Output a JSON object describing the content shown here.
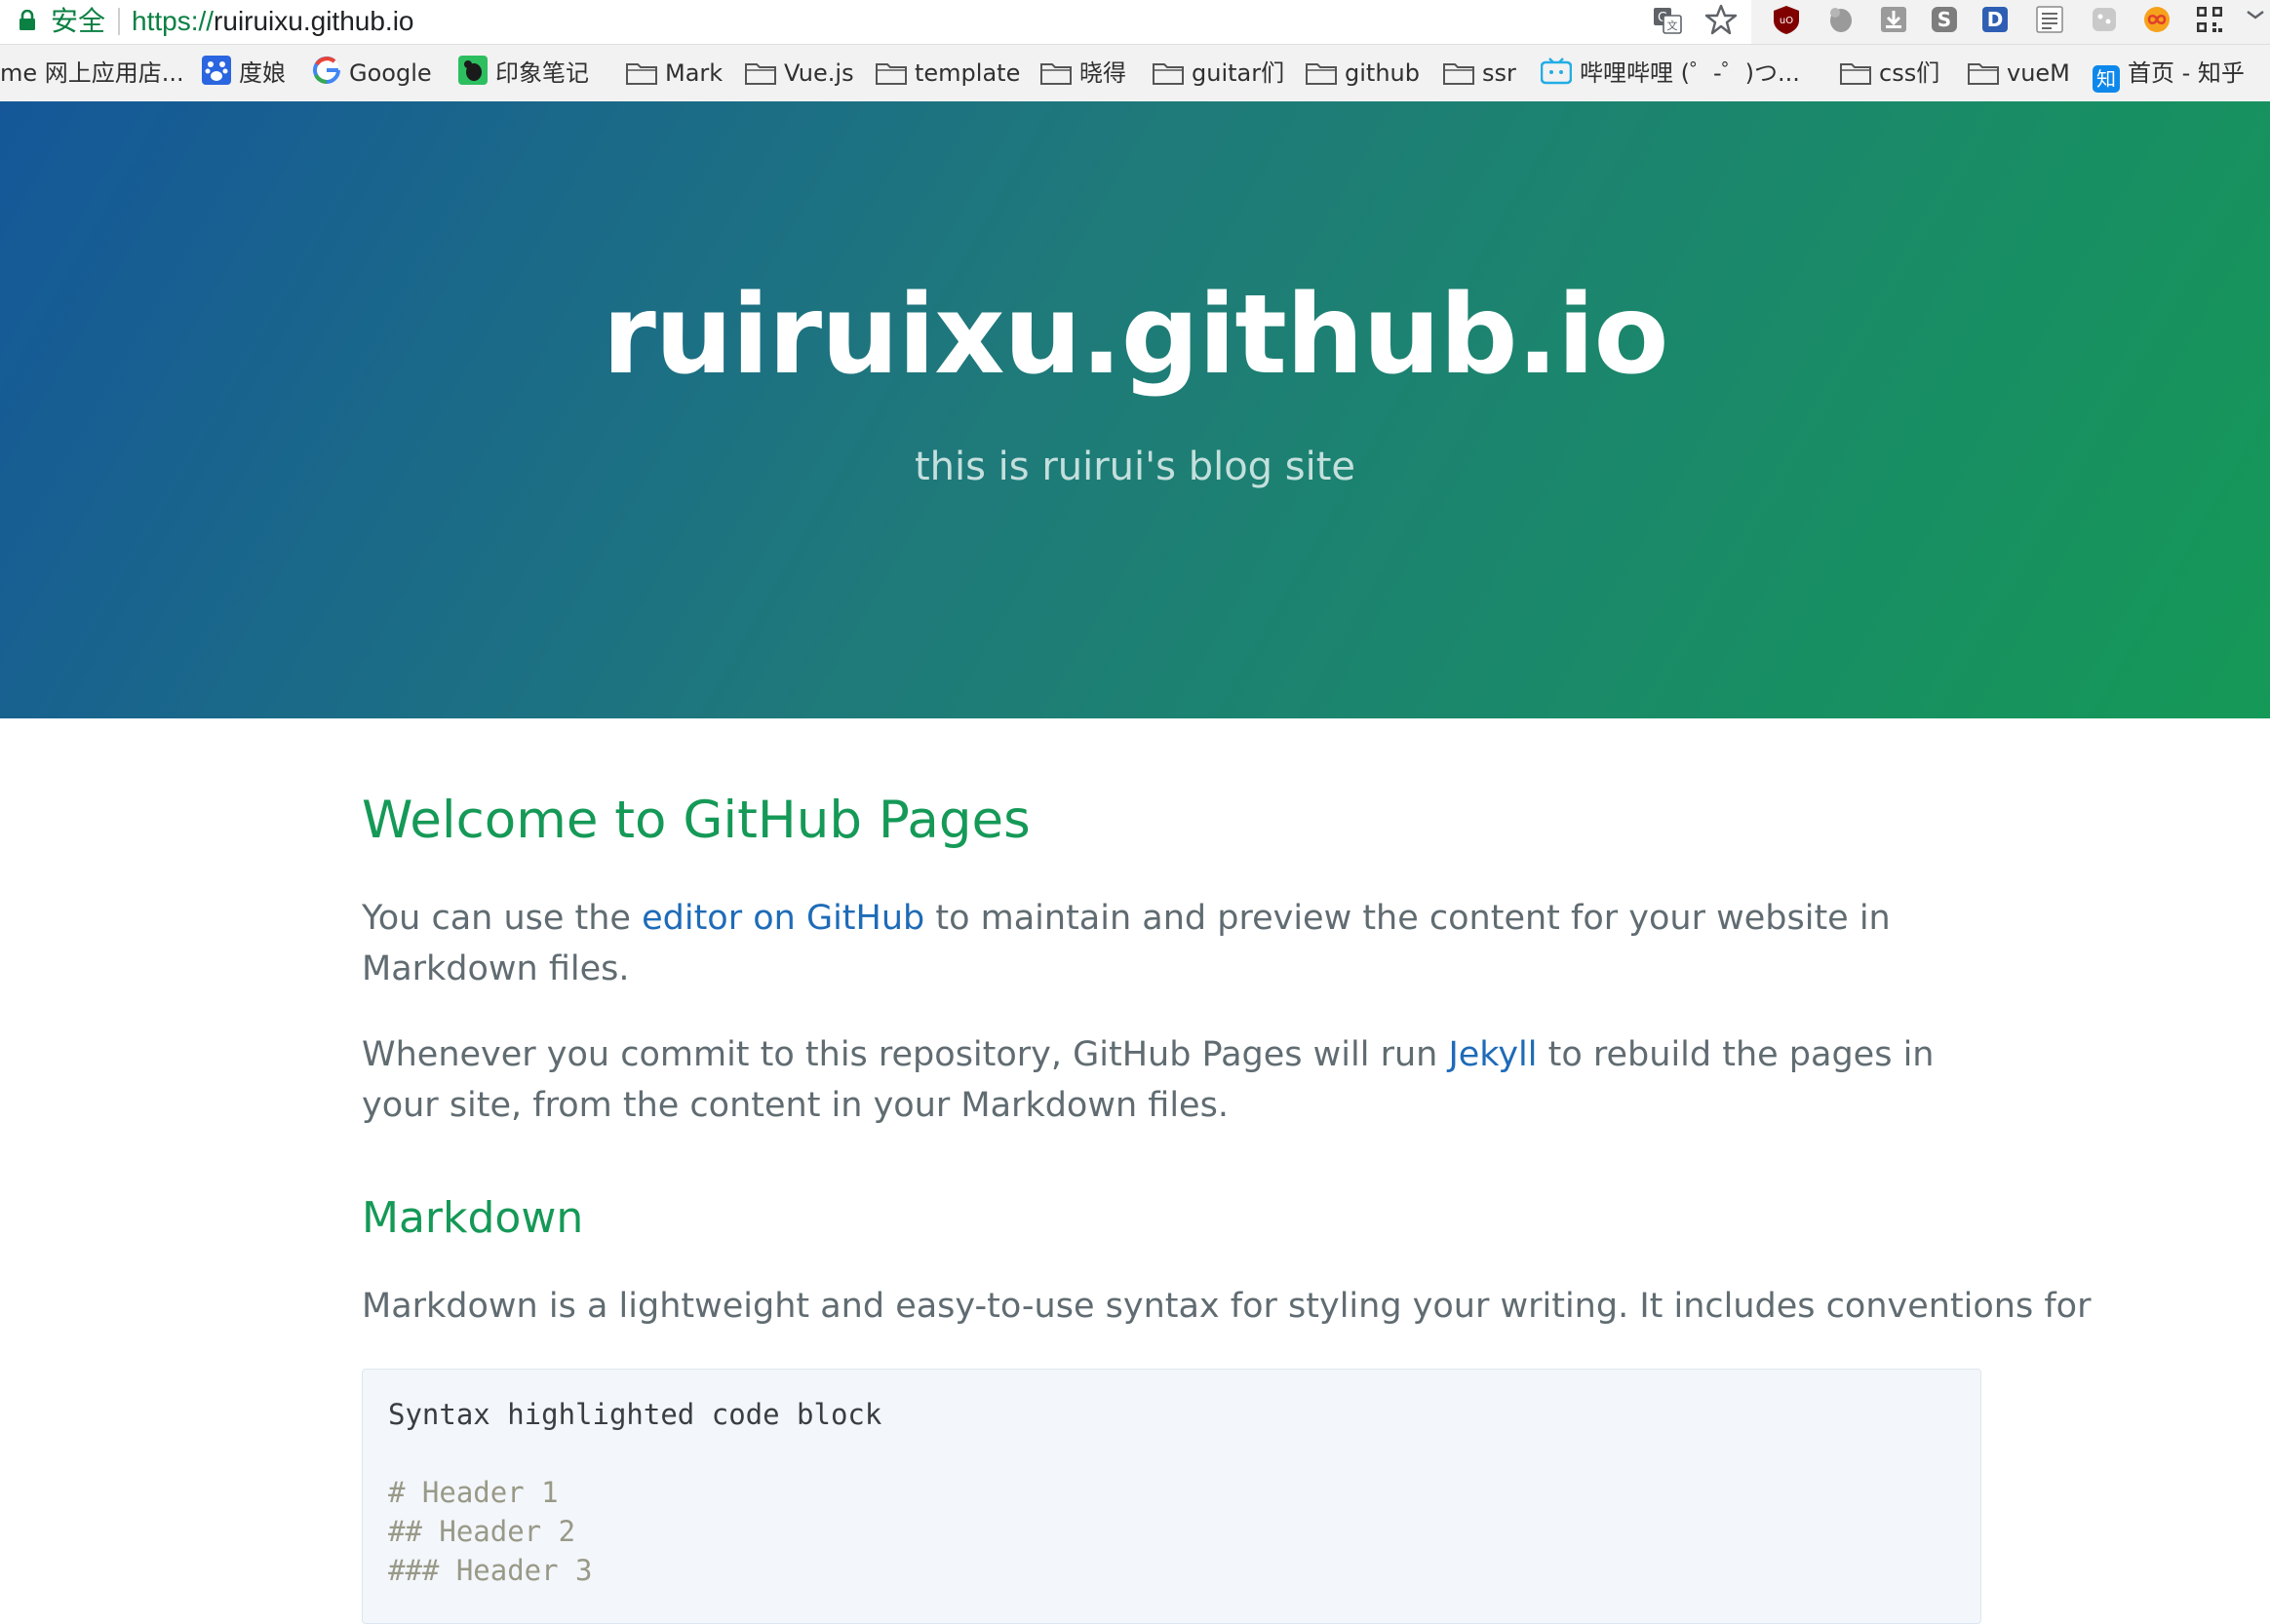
{
  "address_bar": {
    "security_label": "安全",
    "url_scheme": "https://",
    "url_host": "ruiruixu.github.io"
  },
  "bookmarks": [
    {
      "label": "me 网上应用店...",
      "icon": "none"
    },
    {
      "label": "度娘",
      "icon": "baidu-paw-icon"
    },
    {
      "label": "Google",
      "icon": "google-icon"
    },
    {
      "label": "印象笔记",
      "icon": "evernote-icon"
    },
    {
      "label": "Mark",
      "icon": "folder-icon"
    },
    {
      "label": "Vue.js",
      "icon": "folder-icon"
    },
    {
      "label": "template",
      "icon": "folder-icon"
    },
    {
      "label": "晓得",
      "icon": "folder-icon"
    },
    {
      "label": "guitar们",
      "icon": "folder-icon"
    },
    {
      "label": "github",
      "icon": "folder-icon"
    },
    {
      "label": "ssr",
      "icon": "folder-icon"
    },
    {
      "label": "哔哩哔哩 (゜-゜)つ...",
      "icon": "bilibili-icon"
    },
    {
      "label": "css们",
      "icon": "folder-icon"
    },
    {
      "label": "vueM",
      "icon": "folder-icon"
    },
    {
      "label": "首页 - 知乎",
      "icon": "zhihu-icon",
      "icon_text": "知"
    }
  ],
  "hero": {
    "title": "ruiruixu.github.io",
    "tagline": "this is ruirui's blog site"
  },
  "content": {
    "heading": "Welcome to GitHub Pages",
    "p1_before": "You can use the ",
    "p1_link": "editor on GitHub",
    "p1_after": " to maintain and preview the content for your website in Markdown files.",
    "p2_before": "Whenever you commit to this repository, GitHub Pages will run ",
    "p2_link": "Jekyll",
    "p2_after": " to rebuild the pages in your site, from the content in your Markdown files.",
    "subheading": "Markdown",
    "p3": "Markdown is a lightweight and easy-to-use syntax for styling your writing. It includes conventions for",
    "code_lines": [
      "Syntax highlighted code block",
      "# Header 1",
      "## Header 2",
      "### Header 3"
    ]
  },
  "colors": {
    "hero_gradient_start": "#155799",
    "hero_gradient_end": "#159957",
    "heading": "#159957",
    "link": "#1e6bb8",
    "body_text": "#606c71",
    "secure_green": "#0b8043"
  }
}
